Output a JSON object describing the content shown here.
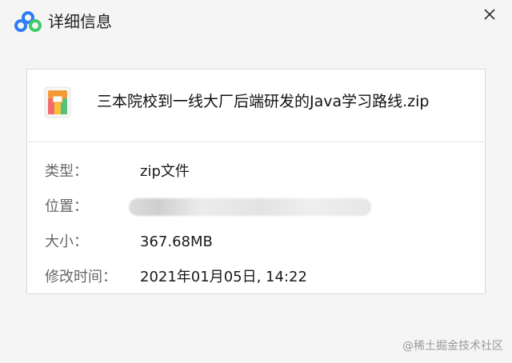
{
  "window": {
    "title": "详细信息",
    "logo_icon": "cloud-logo-icon",
    "close_icon": "close-icon"
  },
  "file": {
    "icon": "zip-archive-icon",
    "name": "三本院校到一线大厂后端研发的Java学习路线.zip"
  },
  "details": {
    "type_label": "类型：",
    "type_value": "zip文件",
    "location_label": "位置：",
    "size_label": "大小：",
    "size_value": "367.68MB",
    "modified_label": "修改时间：",
    "modified_value": "2021年01月05日, 14:22"
  },
  "watermark": "@稀土掘金技术社区",
  "colors": {
    "logo_blue": "#2f7cf6",
    "logo_green": "#3ecb6d",
    "zip_icon_orange": "#f39a34",
    "zip_icon_green": "#54c27a"
  }
}
